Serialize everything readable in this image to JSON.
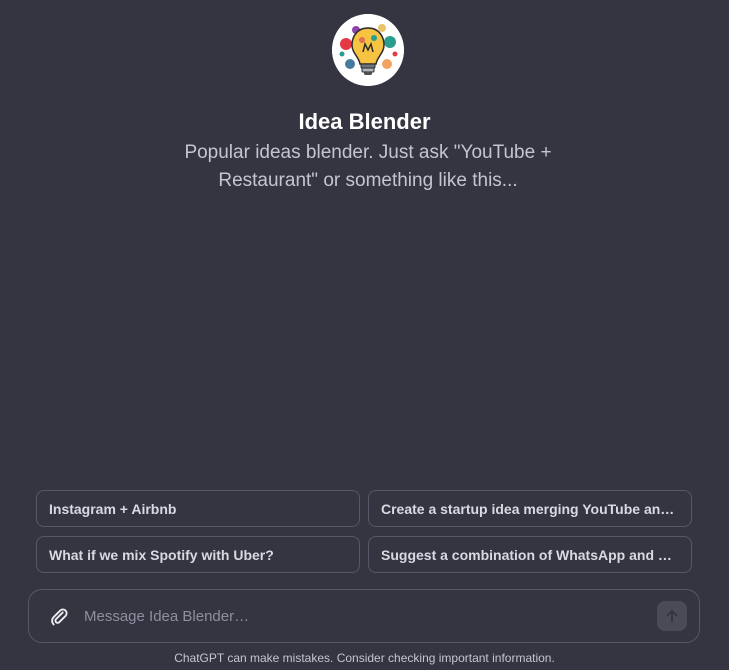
{
  "assistant": {
    "name": "Idea Blender",
    "description": "Popular ideas blender. Just ask \"YouTube + Restaurant\" or something like this..."
  },
  "suggestions": [
    "Instagram + Airbnb",
    "Create a startup idea merging YouTube and Kickstarter",
    "What if we mix Spotify with Uber?",
    "Suggest a combination of WhatsApp and a fitness app"
  ],
  "composer": {
    "placeholder": "Message Idea Blender…",
    "attach_icon": "paperclip-icon",
    "send_icon": "arrow-up-icon"
  },
  "footer": {
    "disclaimer": "ChatGPT can make mistakes. Consider checking important information."
  },
  "colors": {
    "background": "#343541",
    "border": "#565869",
    "text": "#ececf1"
  }
}
